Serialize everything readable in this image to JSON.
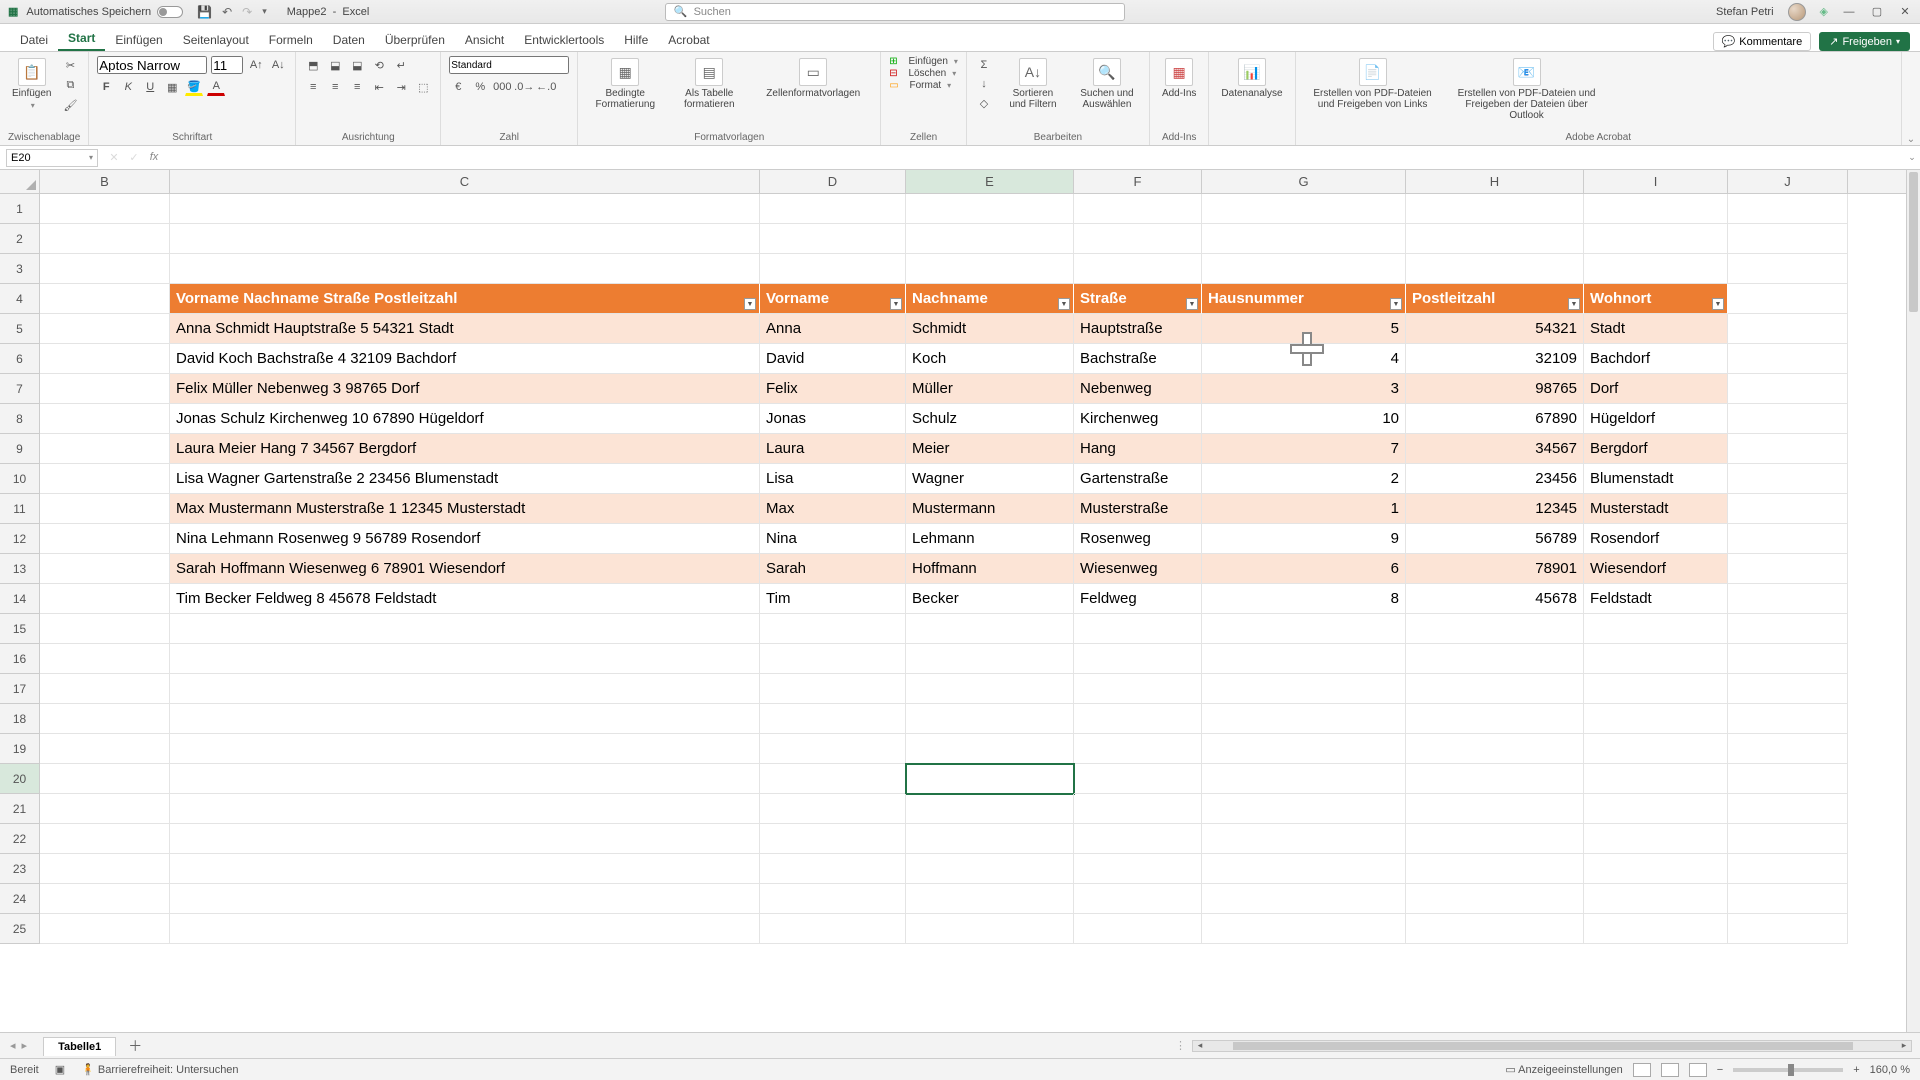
{
  "title": {
    "autosave": "Automatisches Speichern",
    "docname": "Mappe2",
    "appname": "Excel",
    "search_placeholder": "Suchen",
    "user": "Stefan Petri"
  },
  "tabs": {
    "datei": "Datei",
    "start": "Start",
    "einfuegen": "Einfügen",
    "seitenlayout": "Seitenlayout",
    "formeln": "Formeln",
    "daten": "Daten",
    "ueberpruefen": "Überprüfen",
    "ansicht": "Ansicht",
    "entwicklertools": "Entwicklertools",
    "hilfe": "Hilfe",
    "acrobat": "Acrobat",
    "kommentare": "Kommentare",
    "freigeben": "Freigeben"
  },
  "ribbon": {
    "einfuegen_btn": "Einfügen",
    "zwischenablage": "Zwischenablage",
    "fontname": "Aptos Narrow",
    "fontsize": "11",
    "schriftart": "Schriftart",
    "ausrichtung": "Ausrichtung",
    "numfmt": "Standard",
    "zahl": "Zahl",
    "bedingte": "Bedingte Formatierung",
    "alstabelle": "Als Tabelle formatieren",
    "zellenformat": "Zellenformatvorlagen",
    "formatvorlagen": "Formatvorlagen",
    "zeile_einfuegen": "Einfügen",
    "loeschen": "Löschen",
    "format": "Format",
    "zellen": "Zellen",
    "sortieren": "Sortieren und Filtern",
    "suchen": "Suchen und Auswählen",
    "bearbeiten": "Bearbeiten",
    "addins": "Add-Ins",
    "addins_lbl": "Add-Ins",
    "datenanalyse": "Datenanalyse",
    "pdf1": "Erstellen von PDF-Dateien und Freigeben von Links",
    "pdf2": "Erstellen von PDF-Dateien und Freigeben der Dateien über Outlook",
    "adobe": "Adobe Acrobat"
  },
  "namebox": "E20",
  "columns": [
    "B",
    "C",
    "D",
    "E",
    "F",
    "G",
    "H",
    "I",
    "J"
  ],
  "rownums": [
    1,
    2,
    3,
    4,
    5,
    6,
    7,
    8,
    9,
    10,
    11,
    12,
    13,
    14,
    15,
    16,
    17,
    18,
    19,
    20,
    21,
    22,
    23,
    24,
    25
  ],
  "headers": {
    "combined": "Vorname Nachname Straße Postleitzahl",
    "vorname": "Vorname",
    "nachname": "Nachname",
    "strasse": "Straße",
    "hausnr": "Hausnummer",
    "plz": "Postleitzahl",
    "wohnort": "Wohnort"
  },
  "data": [
    {
      "combined": "Anna Schmidt Hauptstraße 5 54321 Stadt",
      "vorname": "Anna",
      "nachname": "Schmidt",
      "strasse": "Hauptstraße",
      "hausnr": "5",
      "plz": "54321",
      "wohnort": "Stadt"
    },
    {
      "combined": "David Koch Bachstraße 4 32109 Bachdorf",
      "vorname": "David",
      "nachname": "Koch",
      "strasse": "Bachstraße",
      "hausnr": "4",
      "plz": "32109",
      "wohnort": "Bachdorf"
    },
    {
      "combined": "Felix Müller Nebenweg 3 98765 Dorf",
      "vorname": "Felix",
      "nachname": "Müller",
      "strasse": "Nebenweg",
      "hausnr": "3",
      "plz": "98765",
      "wohnort": "Dorf"
    },
    {
      "combined": "Jonas Schulz Kirchenweg 10 67890 Hügeldorf",
      "vorname": "Jonas",
      "nachname": "Schulz",
      "strasse": "Kirchenweg",
      "hausnr": "10",
      "plz": "67890",
      "wohnort": "Hügeldorf"
    },
    {
      "combined": "Laura Meier Hang 7 34567 Bergdorf",
      "vorname": "Laura",
      "nachname": "Meier",
      "strasse": "Hang",
      "hausnr": "7",
      "plz": "34567",
      "wohnort": "Bergdorf"
    },
    {
      "combined": "Lisa Wagner Gartenstraße 2 23456 Blumenstadt",
      "vorname": "Lisa",
      "nachname": "Wagner",
      "strasse": "Gartenstraße",
      "hausnr": "2",
      "plz": "23456",
      "wohnort": "Blumenstadt"
    },
    {
      "combined": "Max Mustermann Musterstraße 1 12345 Musterstadt",
      "vorname": "Max",
      "nachname": "Mustermann",
      "strasse": "Musterstraße",
      "hausnr": "1",
      "plz": "12345",
      "wohnort": "Musterstadt"
    },
    {
      "combined": "Nina Lehmann Rosenweg 9 56789 Rosendorf",
      "vorname": "Nina",
      "nachname": "Lehmann",
      "strasse": "Rosenweg",
      "hausnr": "9",
      "plz": "56789",
      "wohnort": "Rosendorf"
    },
    {
      "combined": "Sarah Hoffmann Wiesenweg 6 78901 Wiesendorf",
      "vorname": "Sarah",
      "nachname": "Hoffmann",
      "strasse": "Wiesenweg",
      "hausnr": "6",
      "plz": "78901",
      "wohnort": "Wiesendorf"
    },
    {
      "combined": "Tim Becker Feldweg 8 45678 Feldstadt",
      "vorname": "Tim",
      "nachname": "Becker",
      "strasse": "Feldweg",
      "hausnr": "8",
      "plz": "45678",
      "wohnort": "Feldstadt"
    }
  ],
  "sheet": {
    "name": "Tabelle1"
  },
  "status": {
    "bereit": "Bereit",
    "barrierefrei": "Barrierefreiheit: Untersuchen",
    "anzeige": "Anzeigeeinstellungen",
    "zoom": "160,0 %"
  }
}
